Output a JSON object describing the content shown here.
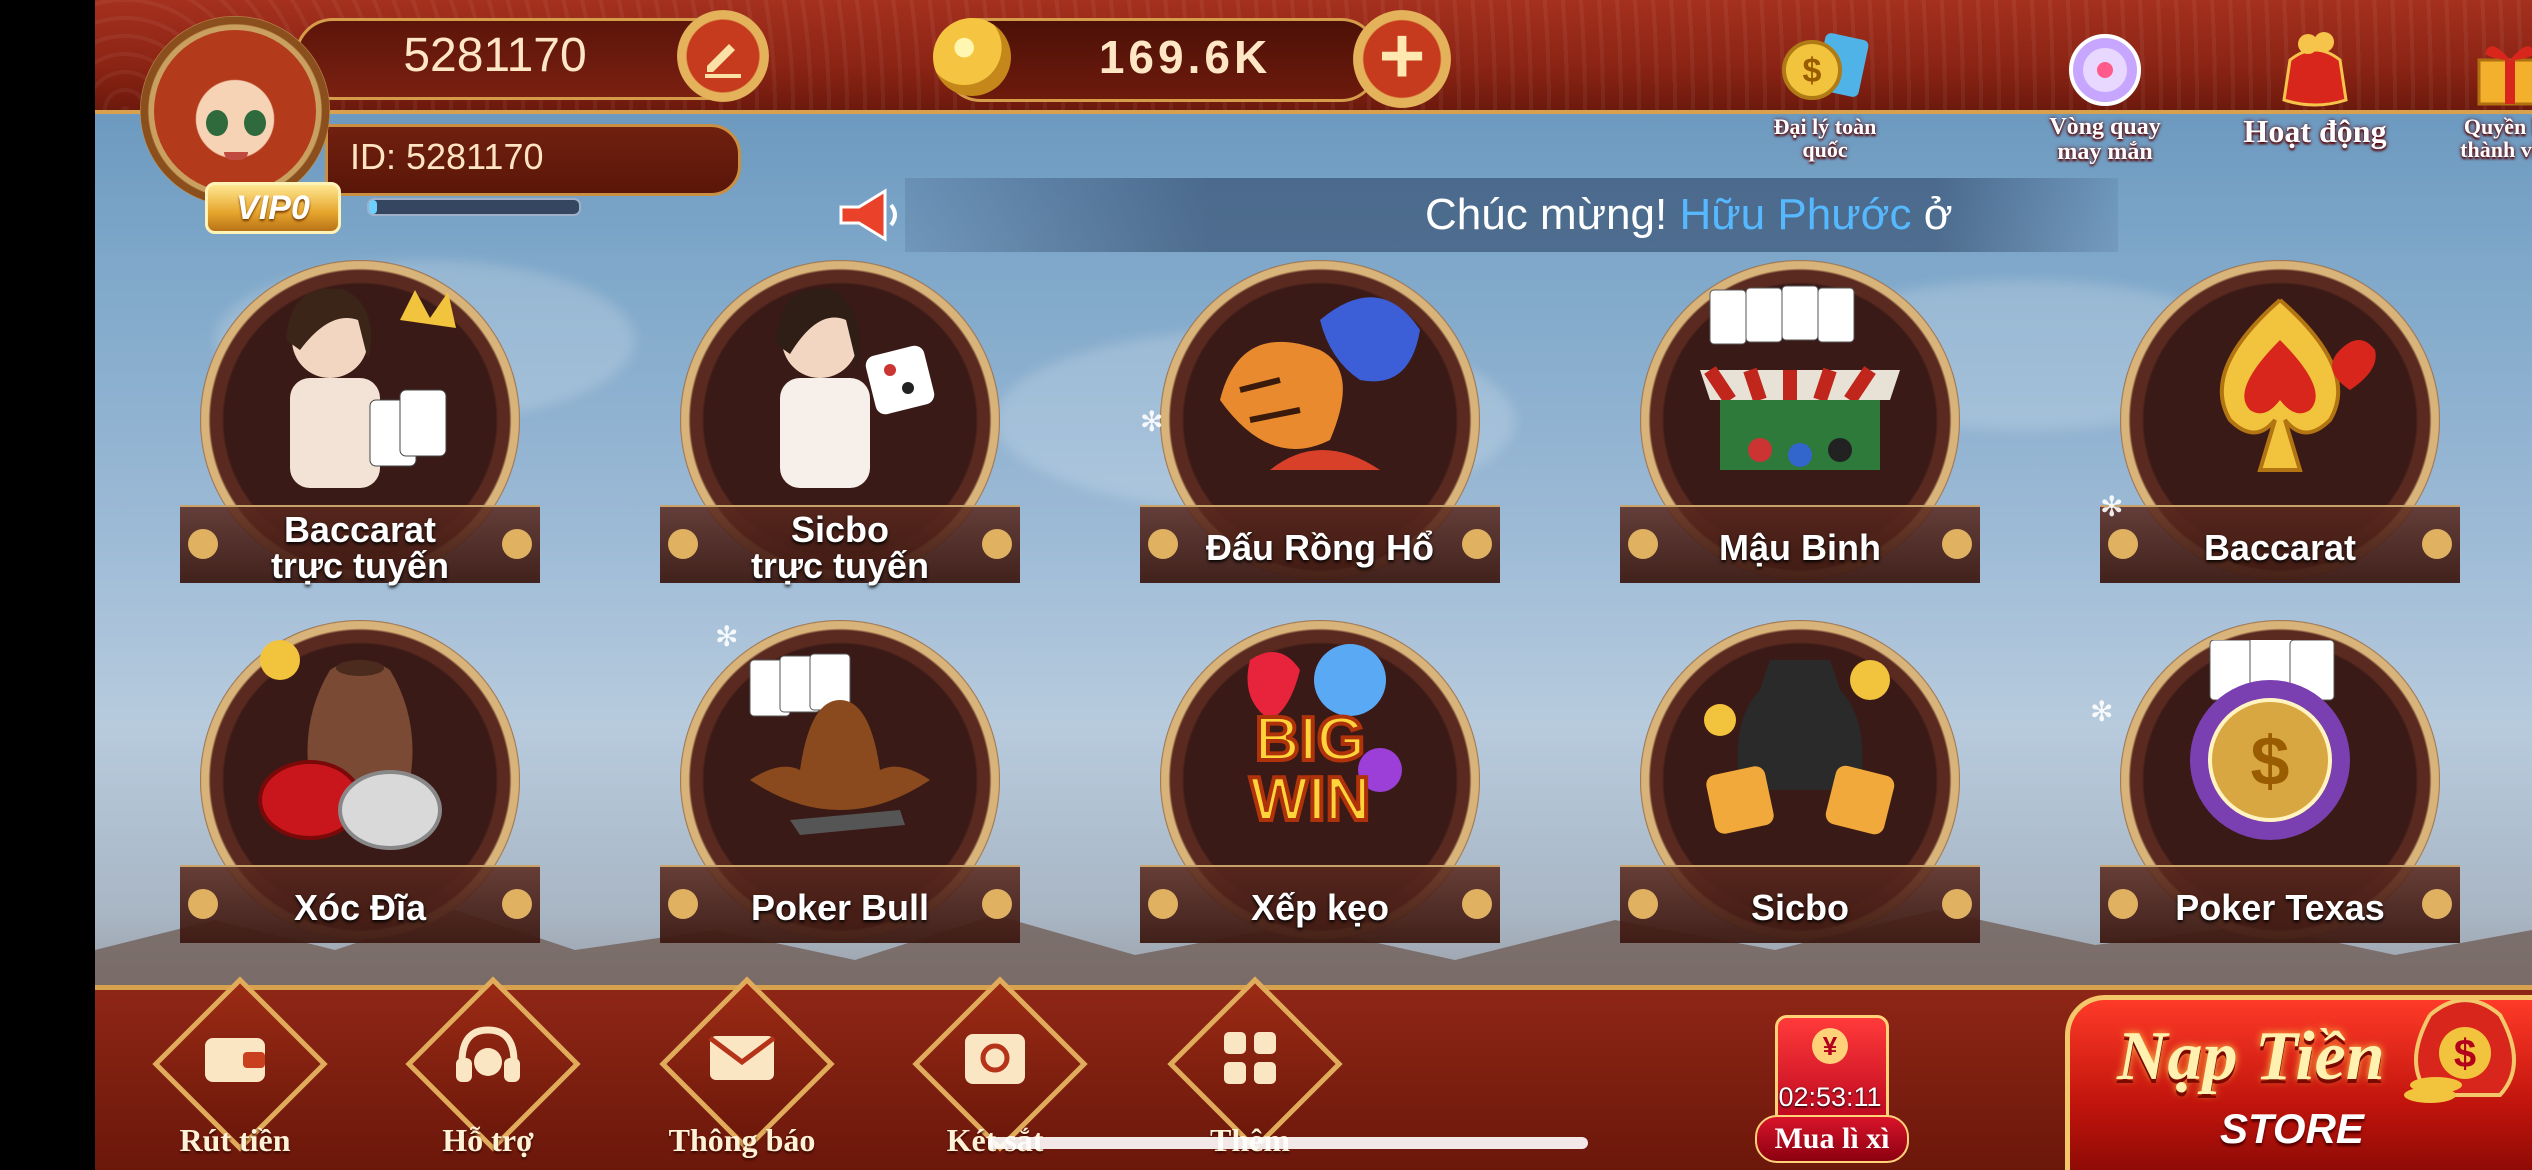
{
  "player": {
    "name": "5281170",
    "id_label": "ID: 5281170",
    "vip": "VIP0",
    "vip_progress": 0.04
  },
  "wallet": {
    "balance": "169.6K"
  },
  "top_icons": [
    {
      "label_line1": "Đại lý toàn",
      "label_line2": "quốc"
    },
    {
      "label_line1": "Vòng quay",
      "label_line2": "may mắn"
    },
    {
      "label_line1": "Hoạt động",
      "label_line2": ""
    },
    {
      "label_line1": "Quyền lợi",
      "label_line2": "thành viên"
    }
  ],
  "marquee": {
    "prefix": "Chúc mừng! ",
    "highlight": "Hữu Phước",
    "suffix": " ở"
  },
  "games": [
    {
      "line1": "Baccarat",
      "line2": "trực tuyến"
    },
    {
      "line1": "Sicbo",
      "line2": "trực tuyến"
    },
    {
      "line1": "Đấu Rồng Hổ",
      "line2": ""
    },
    {
      "line1": "Mậu Binh",
      "line2": ""
    },
    {
      "line1": "Baccarat",
      "line2": ""
    },
    {
      "line1": "Xóc Đĩa",
      "line2": ""
    },
    {
      "line1": "Poker Bull",
      "line2": ""
    },
    {
      "line1": "Xếp kẹo",
      "line2": ""
    },
    {
      "line1": "Sicbo",
      "line2": ""
    },
    {
      "line1": "Poker Texas",
      "line2": ""
    }
  ],
  "game_art": [
    "BIG",
    "WIN"
  ],
  "nav": [
    {
      "label": "Rút tiền",
      "icon": "wallet-icon"
    },
    {
      "label": "Hỗ trợ",
      "icon": "headset-icon"
    },
    {
      "label": "Thông báo",
      "icon": "mail-icon"
    },
    {
      "label": "Két sắt",
      "icon": "safe-icon"
    },
    {
      "label": "Thêm",
      "icon": "grid-icon"
    }
  ],
  "lixi": {
    "symbol": "¥",
    "timer": "02:53:11",
    "label": "Mua lì xì"
  },
  "deposit": {
    "title": "Nạp Tiền",
    "store": "STORE"
  },
  "colors": {
    "accent_gold": "#d8a14d",
    "bar_red": "#8b2414",
    "highlight_blue": "#56b8ff"
  }
}
